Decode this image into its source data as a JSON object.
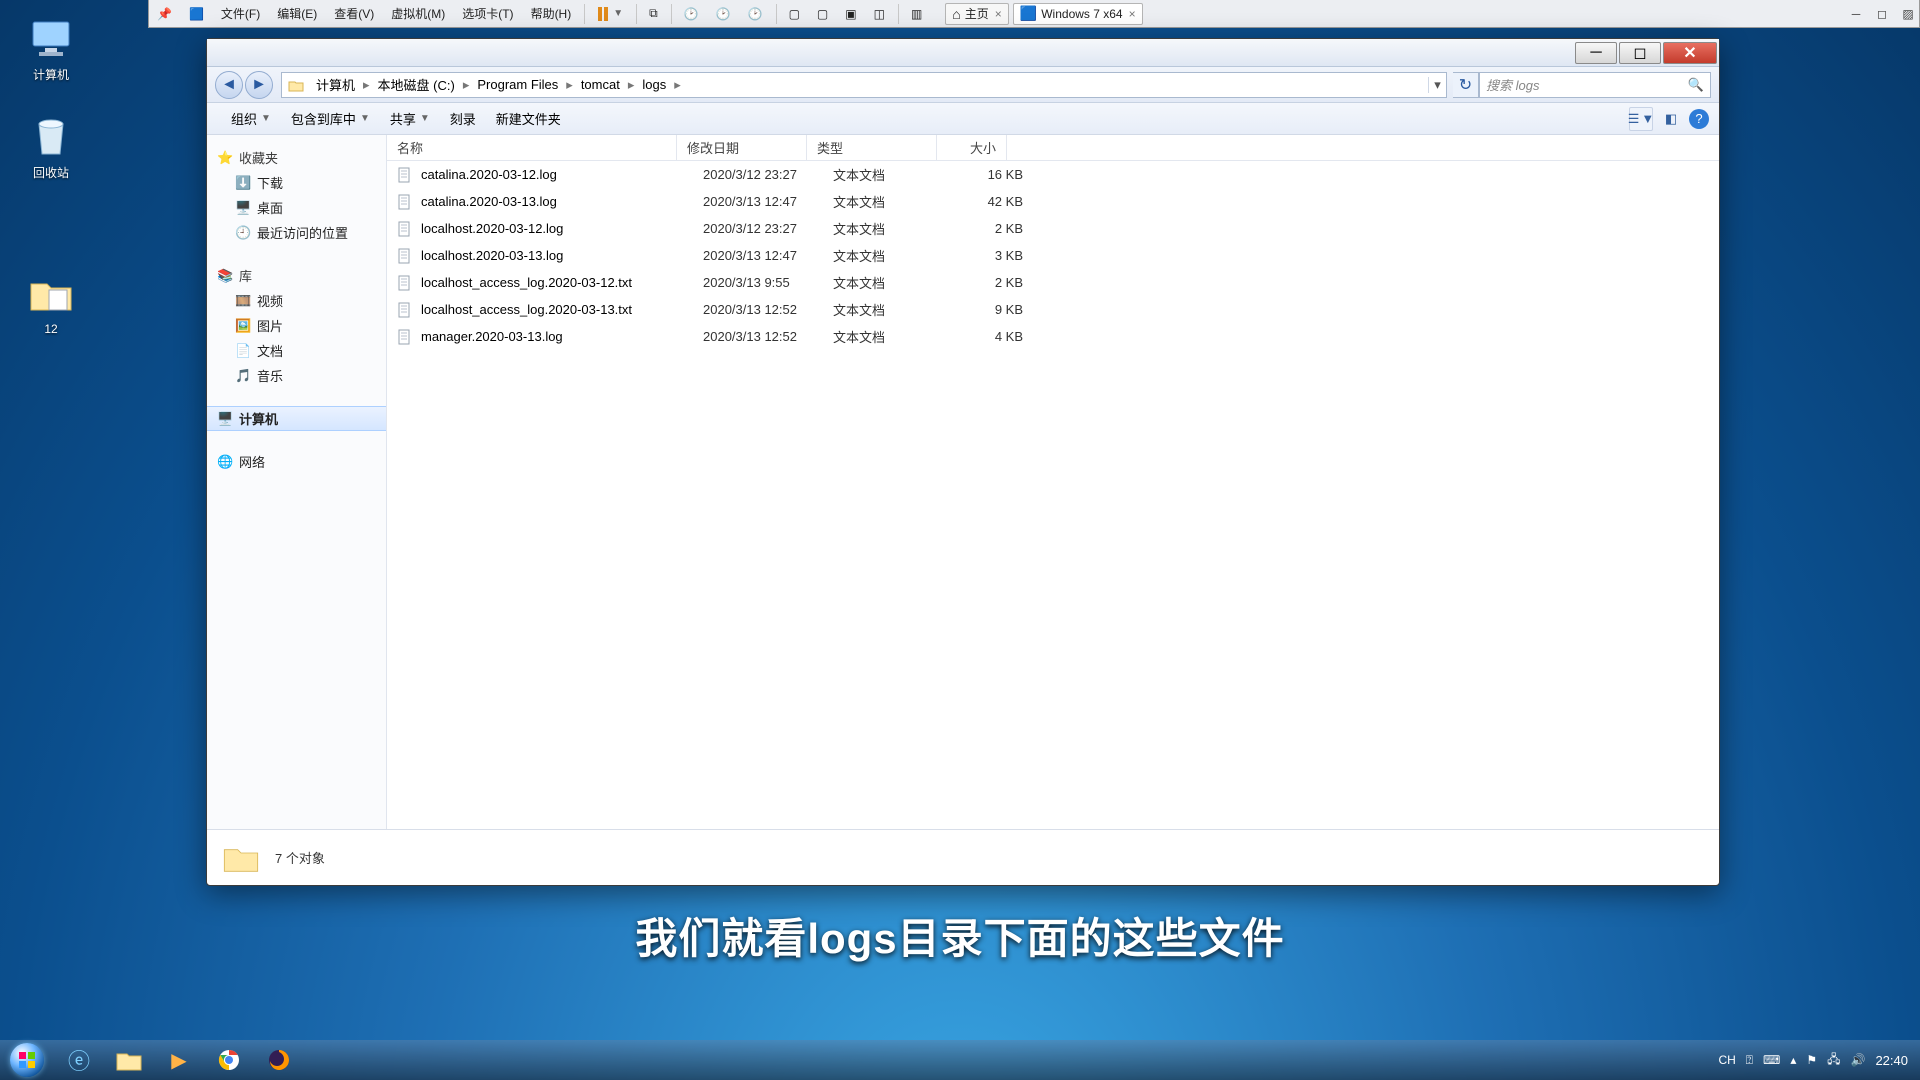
{
  "host_menu": {
    "items": [
      "文件(F)",
      "编辑(E)",
      "查看(V)",
      "虚拟机(M)",
      "选项卡(T)",
      "帮助(H)"
    ],
    "tabs": [
      {
        "icon": "home",
        "label": "主页"
      },
      {
        "icon": "win",
        "label": "Windows 7 x64",
        "active": true
      }
    ]
  },
  "desktop": {
    "computer": "计算机",
    "recycle": "回收站",
    "folder": "12"
  },
  "explorer": {
    "breadcrumbs": [
      "计算机",
      "本地磁盘 (C:)",
      "Program Files",
      "tomcat",
      "logs"
    ],
    "search_placeholder": "搜索 logs",
    "toolbar": {
      "organize": "组织",
      "include": "包含到库中",
      "share": "共享",
      "burn": "刻录",
      "newfolder": "新建文件夹"
    },
    "sidebar": {
      "favorites": {
        "head": "收藏夹",
        "items": [
          "下载",
          "桌面",
          "最近访问的位置"
        ]
      },
      "libraries": {
        "head": "库",
        "items": [
          "视频",
          "图片",
          "文档",
          "音乐"
        ]
      },
      "computer": "计算机",
      "network": "网络"
    },
    "columns": {
      "name": "名称",
      "date": "修改日期",
      "type": "类型",
      "size": "大小"
    },
    "files": [
      {
        "name": "catalina.2020-03-12.log",
        "date": "2020/3/12 23:27",
        "type": "文本文档",
        "size": "16 KB"
      },
      {
        "name": "catalina.2020-03-13.log",
        "date": "2020/3/13 12:47",
        "type": "文本文档",
        "size": "42 KB"
      },
      {
        "name": "localhost.2020-03-12.log",
        "date": "2020/3/12 23:27",
        "type": "文本文档",
        "size": "2 KB"
      },
      {
        "name": "localhost.2020-03-13.log",
        "date": "2020/3/13 12:47",
        "type": "文本文档",
        "size": "3 KB"
      },
      {
        "name": "localhost_access_log.2020-03-12.txt",
        "date": "2020/3/13 9:55",
        "type": "文本文档",
        "size": "2 KB"
      },
      {
        "name": "localhost_access_log.2020-03-13.txt",
        "date": "2020/3/13 12:52",
        "type": "文本文档",
        "size": "9 KB"
      },
      {
        "name": "manager.2020-03-13.log",
        "date": "2020/3/13 12:52",
        "type": "文本文档",
        "size": "4 KB"
      }
    ],
    "status": "7 个对象"
  },
  "subtitle": "我们就看logs目录下面的这些文件",
  "tray": {
    "ime": "CH",
    "clock": "22:40"
  }
}
